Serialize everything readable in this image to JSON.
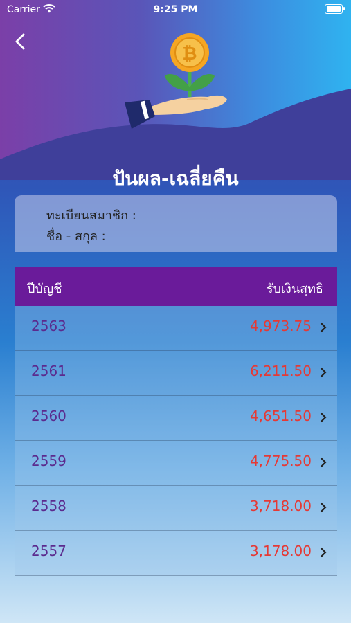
{
  "status_bar": {
    "carrier": "Carrier",
    "time": "9:25 PM"
  },
  "header": {
    "title": "ปันผล-เฉลี่ยคืน"
  },
  "member": {
    "registration_label": "ทะเบียนสมาชิก :",
    "name_label": "ชื่อ - สกุล :"
  },
  "table": {
    "col_year": "ปีบัญชี",
    "col_amount": "รับเงินสุทธิ",
    "rows": [
      {
        "year": "2563",
        "amount": "4,973.75"
      },
      {
        "year": "2561",
        "amount": "6,211.50"
      },
      {
        "year": "2560",
        "amount": "4,651.50"
      },
      {
        "year": "2559",
        "amount": "4,775.50"
      },
      {
        "year": "2558",
        "amount": "3,718.00"
      },
      {
        "year": "2557",
        "amount": "3,178.00"
      }
    ]
  },
  "icons": [
    "wifi-icon",
    "battery-icon",
    "back-chevron-icon",
    "hand-plant-coin-icon",
    "chevron-right-icon"
  ],
  "colors": {
    "header_bg": "#6a1b9a",
    "amount": "#e53935",
    "year": "#5b2a8e"
  }
}
